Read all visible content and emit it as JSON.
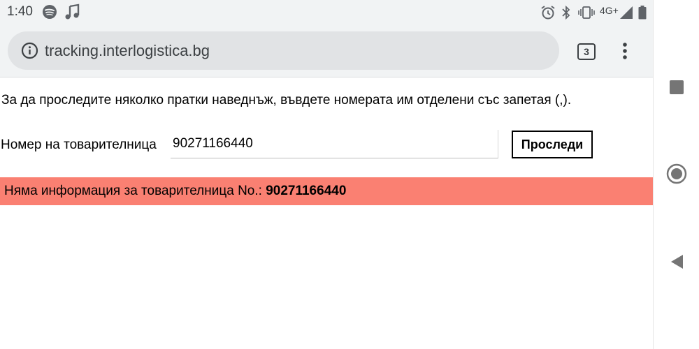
{
  "status_bar": {
    "time": "1:40",
    "network": "4G+",
    "icons": [
      "spotify-icon",
      "music-note-icon",
      "alarm-icon",
      "bluetooth-icon",
      "vibrate-icon",
      "signal-icon",
      "battery-icon"
    ]
  },
  "browser": {
    "url": "tracking.interlogistica.bg",
    "tab_count": "3",
    "icons": [
      "info-icon",
      "overflow-menu-icon"
    ]
  },
  "page": {
    "instruction": "За да проследите няколко пратки наведнъж, въвдете номерата им отделени със запетая (,).",
    "field_label": "Номер на товарителница",
    "input_value": "90271166440",
    "button_label": "Проследи",
    "alert_prefix": "Няма информация за товарителница No.:",
    "alert_number": "90271166440"
  },
  "nav_bar": {
    "icons": [
      "recents-icon",
      "home-icon",
      "back-icon"
    ]
  },
  "colors": {
    "alert_bg": "#fa8072",
    "toolbar_bg": "#f1f3f4",
    "omnibox_bg": "#e1e3e5"
  }
}
